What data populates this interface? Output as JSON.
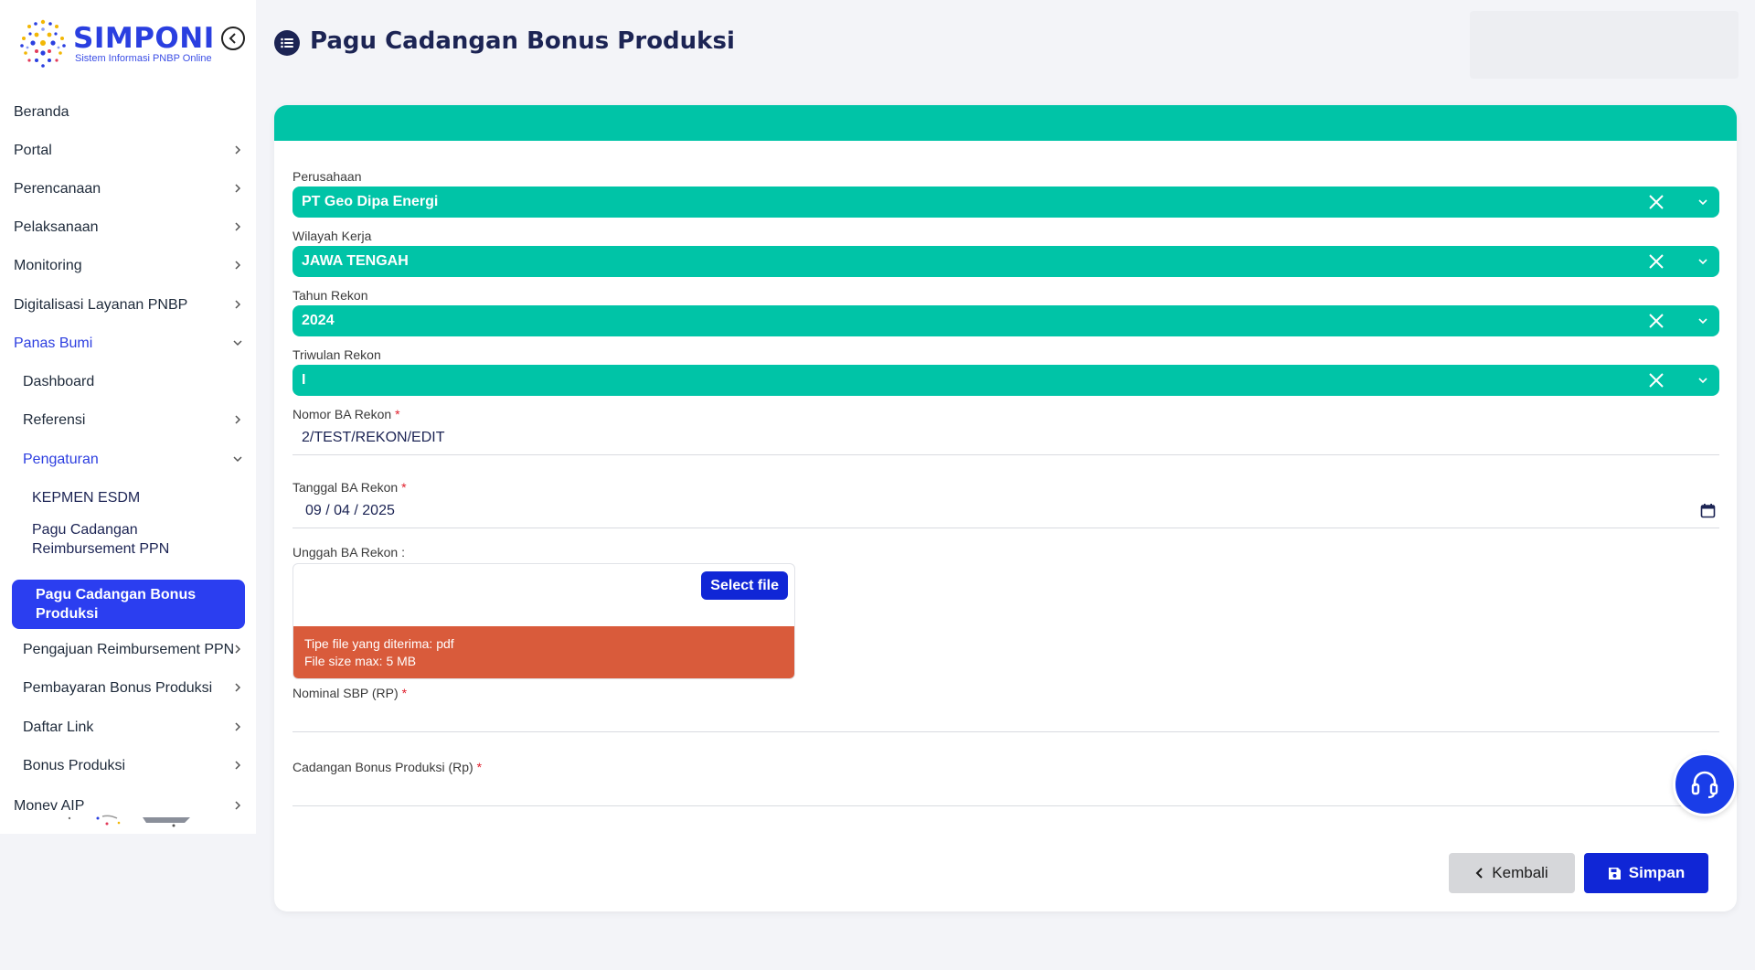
{
  "app": {
    "logo_title": "SIMPONI",
    "logo_subtitle": "Sistem Informasi PNBP Online"
  },
  "sidebar": {
    "items": [
      {
        "label": "Beranda"
      },
      {
        "label": "Portal"
      },
      {
        "label": "Perencanaan"
      },
      {
        "label": "Pelaksanaan"
      },
      {
        "label": "Monitoring"
      },
      {
        "label": "Digitalisasi Layanan PNBP"
      },
      {
        "label": "Panas Bumi"
      },
      {
        "label": "Dashboard"
      },
      {
        "label": "Referensi"
      },
      {
        "label": "Pengaturan"
      },
      {
        "label": "KEPMEN ESDM"
      },
      {
        "label": "Pagu Cadangan Reimbursement PPN"
      },
      {
        "label": "Pagu Cadangan Bonus Produksi"
      },
      {
        "label": "Pengajuan Reimbursement PPN"
      },
      {
        "label": "Pembayaran Bonus Produksi"
      },
      {
        "label": "Daftar Link"
      },
      {
        "label": "Bonus Produksi"
      },
      {
        "label": "Monev AIP"
      }
    ]
  },
  "page": {
    "title": "Pagu Cadangan Bonus Produksi"
  },
  "form": {
    "perusahaan": {
      "label": "Perusahaan",
      "value": "PT Geo Dipa Energi"
    },
    "wilayah_kerja": {
      "label": "Wilayah Kerja",
      "value": "JAWA TENGAH"
    },
    "tahun_rekon": {
      "label": "Tahun Rekon",
      "value": "2024"
    },
    "triwulan_rekon": {
      "label": "Triwulan Rekon",
      "value": "I"
    },
    "nomor_ba": {
      "label": "Nomor BA Rekon",
      "required": "*",
      "value": "2/TEST/REKON/EDIT"
    },
    "tanggal_ba": {
      "label": "Tanggal BA Rekon",
      "required": "*",
      "value": "09 / 04 / 2025"
    },
    "unggah_ba": {
      "label": "Unggah BA Rekon :",
      "button": "Select file",
      "info_line1": "Tipe file yang diterima: pdf",
      "info_line2": "File size max: 5 MB"
    },
    "nominal_sbp": {
      "label": "Nominal SBP (RP)",
      "required": "*",
      "value": ""
    },
    "cadangan_bonus": {
      "label": "Cadangan Bonus Produksi (Rp)",
      "required": "*",
      "value": ""
    }
  },
  "actions": {
    "back": "Kembali",
    "save": "Simpan"
  },
  "colors": {
    "primary": "#1026d6",
    "teal": "#00c4a7",
    "warning": "#d95b3b",
    "navy": "#1c2454"
  }
}
